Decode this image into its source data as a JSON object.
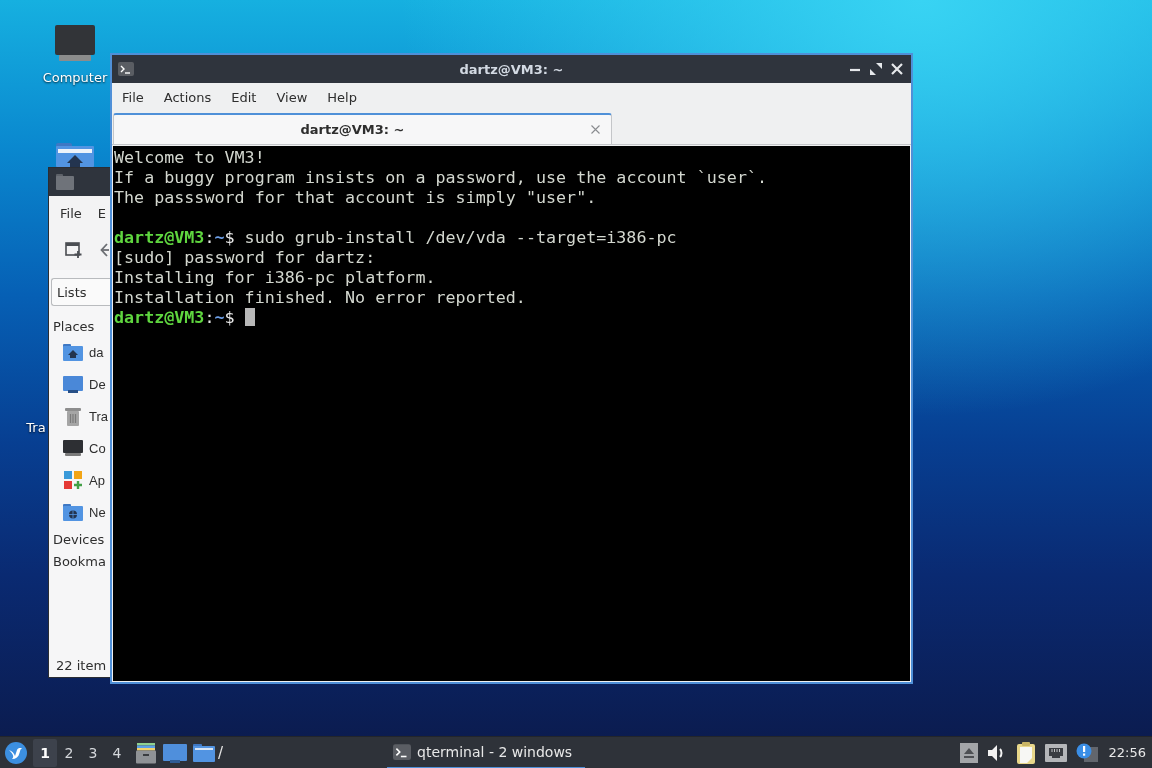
{
  "desktop_icons": [
    {
      "kind": "computer",
      "label": "Computer"
    },
    {
      "kind": "home_folder"
    },
    {
      "kind": "trash",
      "label": "Tra"
    }
  ],
  "file_manager": {
    "menu": [
      "File",
      "E"
    ],
    "view_selector": "Lists",
    "sidebar": [
      {
        "title": "Places",
        "items": [
          {
            "kind": "home",
            "label": "da"
          },
          {
            "kind": "desktop",
            "label": "De"
          },
          {
            "kind": "trash",
            "label": "Tra"
          },
          {
            "kind": "computer",
            "label": "Co"
          },
          {
            "kind": "applications",
            "label": "Ap"
          },
          {
            "kind": "network",
            "label": "Ne"
          }
        ]
      },
      {
        "title": "Devices"
      },
      {
        "title": "Bookma"
      }
    ],
    "status_bar": "22 item"
  },
  "terminal": {
    "title": "dartz@VM3: ~",
    "menu": [
      "File",
      "Actions",
      "Edit",
      "View",
      "Help"
    ],
    "tabs": [
      {
        "label": "dartz@VM3: ~",
        "selected": true
      }
    ],
    "lines": [
      {
        "kind": "output",
        "text": "Welcome to VM3!"
      },
      {
        "kind": "output",
        "text": "If a buggy program insists on a password, use the account `user`."
      },
      {
        "kind": "output",
        "text": "The passsword for that account is simply \"user\"."
      },
      {
        "kind": "blank"
      },
      {
        "kind": "prompt",
        "user_host": "dartz@VM3",
        "separator": ":",
        "path": "~",
        "symbol": "$",
        "command": "sudo grub-install /dev/vda --target=i386-pc",
        "cursor": false
      },
      {
        "kind": "output",
        "text": "[sudo] password for dartz:"
      },
      {
        "kind": "output",
        "text": "Installing for i386-pc platform."
      },
      {
        "kind": "output",
        "text": "Installation finished. No error reported."
      },
      {
        "kind": "prompt",
        "user_host": "dartz@VM3",
        "separator": ":",
        "path": "~",
        "symbol": "$",
        "cursor": true
      }
    ]
  },
  "taskbar": {
    "workspaces": [
      {
        "label": "1",
        "selected": true
      },
      {
        "label": "2",
        "selected": false
      },
      {
        "label": "3",
        "selected": false
      },
      {
        "label": "4",
        "selected": false
      }
    ],
    "launchers": [
      {
        "kind": "file_cabinet"
      },
      {
        "kind": "display"
      },
      {
        "kind": "folder",
        "label": "/"
      }
    ],
    "tasks": [
      {
        "label": "qterminal - 2 windows",
        "selected": true
      }
    ],
    "clock": "22:56"
  }
}
